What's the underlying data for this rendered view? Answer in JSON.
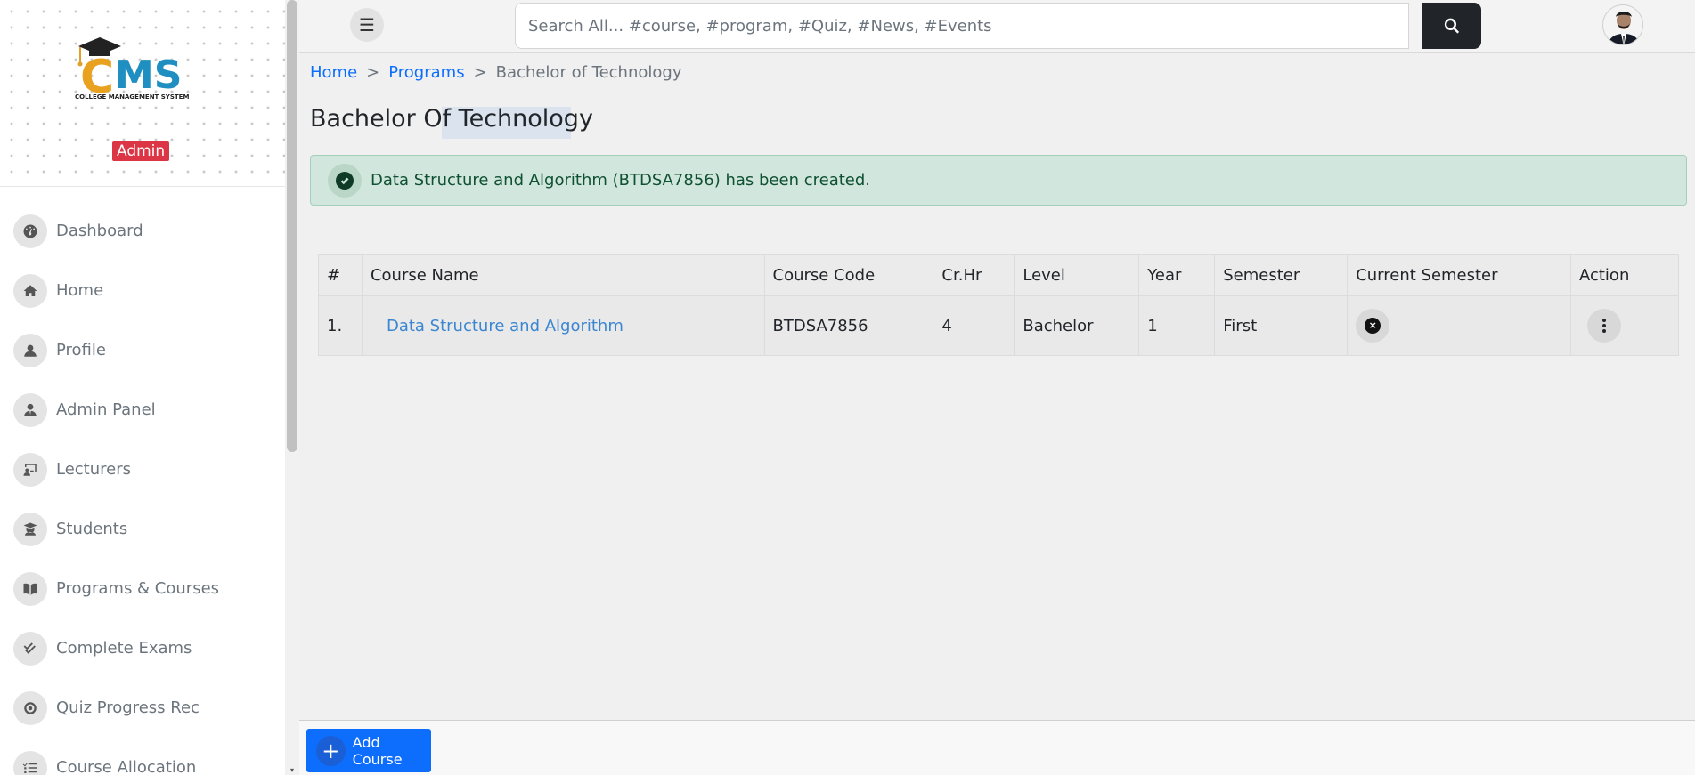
{
  "sidebar": {
    "logo_text": "CMS",
    "logo_subtitle": "COLLEGE MANAGEMENT SYSTEM",
    "role_badge": "Admin",
    "items": [
      {
        "label": "Dashboard",
        "icon": "dashboard-icon"
      },
      {
        "label": "Home",
        "icon": "home-icon"
      },
      {
        "label": "Profile",
        "icon": "user-icon"
      },
      {
        "label": "Admin Panel",
        "icon": "user-tie-icon"
      },
      {
        "label": "Lecturers",
        "icon": "chalkboard-teacher-icon"
      },
      {
        "label": "Students",
        "icon": "graduate-icon"
      },
      {
        "label": "Programs & Courses",
        "icon": "book-open-icon"
      },
      {
        "label": "Complete Exams",
        "icon": "check-double-icon"
      },
      {
        "label": "Quiz Progress Rec",
        "icon": "record-icon"
      },
      {
        "label": "Course Allocation",
        "icon": "list-check-icon"
      }
    ]
  },
  "topbar": {
    "search_placeholder": "Search All... #course, #program, #Quiz, #News, #Events"
  },
  "breadcrumb": {
    "home": "Home",
    "programs": "Programs",
    "current": "Bachelor of Technology",
    "separator": ">"
  },
  "page_title": "Bachelor Of Technology",
  "alert": {
    "message": "Data Structure and Algorithm (BTDSA7856) has been created.",
    "color": "#d1e7dd"
  },
  "table": {
    "headers": [
      "#",
      "Course Name",
      "Course Code",
      "Cr.Hr",
      "Level",
      "Year",
      "Semester",
      "Current Semester",
      "Action"
    ],
    "rows": [
      {
        "num": "1.",
        "course_name": "Data Structure and Algorithm",
        "course_code": "BTDSA7856",
        "cr_hr": "4",
        "level": "Bachelor",
        "year": "1",
        "semester": "First",
        "current_semester_icon": "x-circle-icon",
        "action_icon": "kebab-menu-icon"
      }
    ]
  },
  "footer": {
    "add_course_label": "Add Course"
  },
  "colors": {
    "primary": "#0d6efd",
    "danger": "#dc3545",
    "dark": "#212529",
    "success_bg": "#d1e7dd"
  }
}
